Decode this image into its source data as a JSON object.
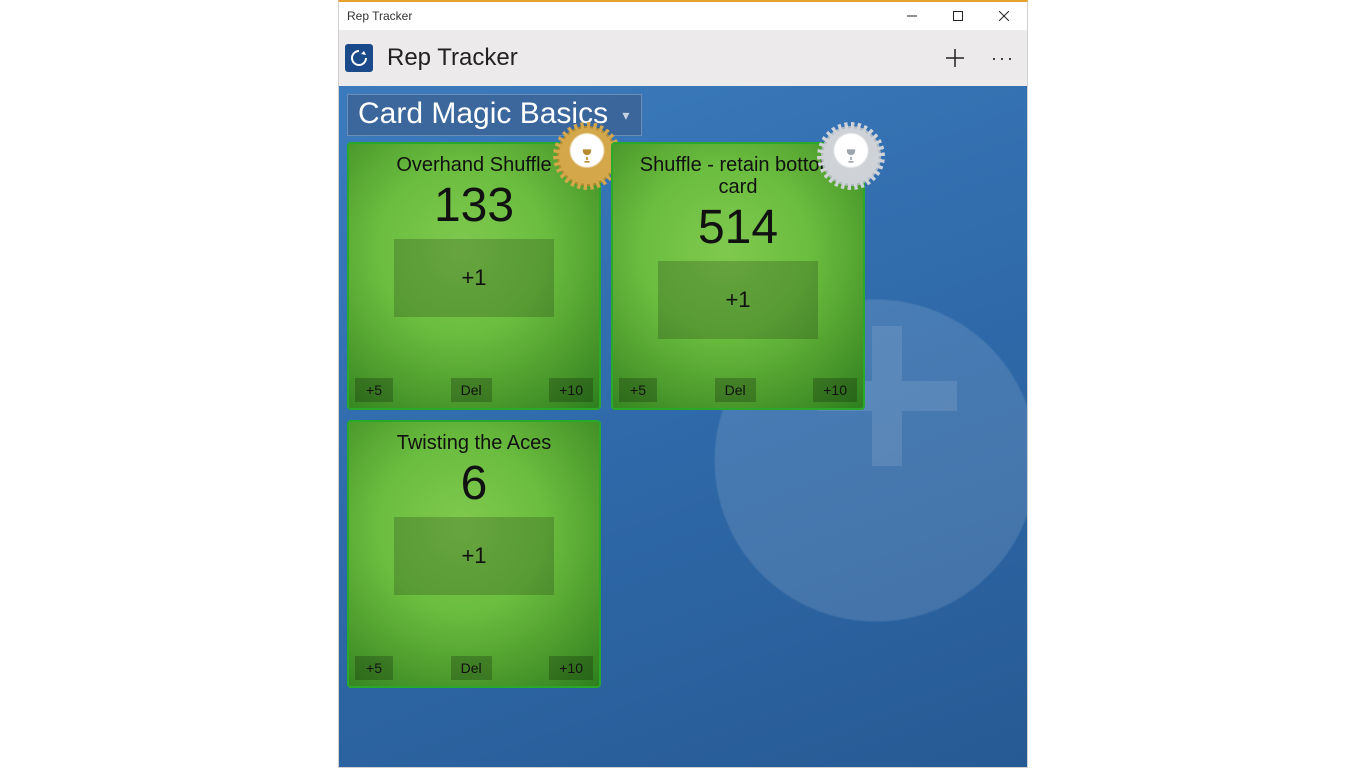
{
  "window_title": "Rep Tracker",
  "app_name": "Rep Tracker",
  "group_selected": "Card Magic Basics",
  "buttons": {
    "plus1": "+1",
    "plus5": "+5",
    "del": "Del",
    "plus10": "+10"
  },
  "cards": [
    {
      "name": "Overhand Shuffle",
      "count": "133",
      "badge": "gold"
    },
    {
      "name": "Shuffle - retain bottom card",
      "count": "514",
      "badge": "silver"
    },
    {
      "name": "Twisting the Aces",
      "count": "6",
      "badge": null
    }
  ]
}
